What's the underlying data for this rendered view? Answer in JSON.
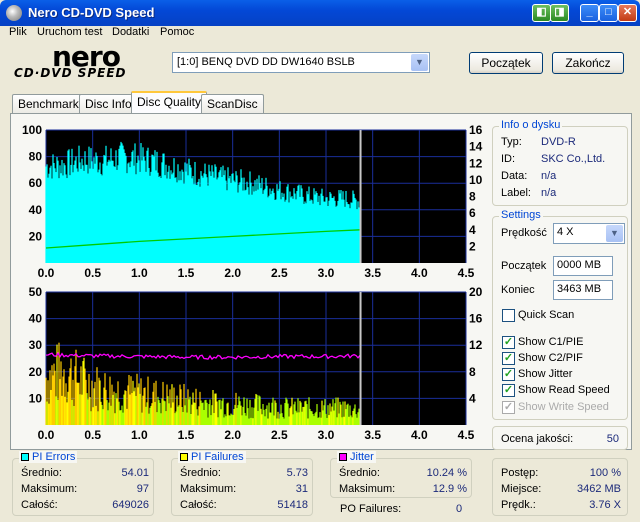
{
  "window": {
    "title": "Nero CD-DVD Speed"
  },
  "menu": [
    "Plik",
    "Uruchom test",
    "Dodatki",
    "Pomoc"
  ],
  "logo": {
    "top": "nero",
    "bottom": "CD·DVD SPEED"
  },
  "drive": {
    "selected": "[1:0]  BENQ DVD DD DW1640 BSLB"
  },
  "buttons": {
    "start": "Początek",
    "end": "Zakończ"
  },
  "tabs": [
    "Benchmark",
    "Disc Info",
    "Disc Quality",
    "ScanDisc"
  ],
  "disc_info": {
    "legend": "Info o dysku",
    "rows": [
      {
        "label": "Typ:",
        "value": "DVD-R"
      },
      {
        "label": "ID:",
        "value": "SKC Co.,Ltd."
      },
      {
        "label": "Data:",
        "value": "n/a"
      },
      {
        "label": "Label:",
        "value": "n/a"
      }
    ]
  },
  "settings": {
    "legend": "Settings",
    "speed_label": "Prędkość",
    "speed_value": "4 X",
    "start_label": "Początek",
    "start_value": "0000 MB",
    "end_label": "Koniec",
    "end_value": "3463 MB",
    "quick_scan": "Quick Scan",
    "checks": [
      {
        "label": "Show C1/PIE",
        "checked": true,
        "disabled": false
      },
      {
        "label": "Show C2/PIF",
        "checked": true,
        "disabled": false
      },
      {
        "label": "Show Jitter",
        "checked": true,
        "disabled": false
      },
      {
        "label": "Show Read Speed",
        "checked": true,
        "disabled": false
      },
      {
        "label": "Show Write Speed",
        "checked": true,
        "disabled": true
      }
    ]
  },
  "quality": {
    "label": "Ocena jakości:",
    "value": "50"
  },
  "pi_errors": {
    "legend": "PI Errors",
    "color": "#00ffff",
    "avg_label": "Średnio:",
    "avg": "54.01",
    "max_label": "Maksimum:",
    "max": "97",
    "total_label": "Całość:",
    "total": "649026"
  },
  "pi_failures": {
    "legend": "PI Failures",
    "color": "#ffff00",
    "avg_label": "Średnio:",
    "avg": "5.73",
    "max_label": "Maksimum:",
    "max": "31",
    "total_label": "Całość:",
    "total": "51418"
  },
  "jitter": {
    "legend": "Jitter",
    "color": "#ff00ff",
    "avg_label": "Średnio:",
    "avg": "10.24 %",
    "max_label": "Maksimum:",
    "max": "12.9 %",
    "po_label": "PO Failures:",
    "po": "0"
  },
  "progress": {
    "progress_label": "Postęp:",
    "progress": "100 %",
    "place_label": "Miejsce:",
    "place": "3462 MB",
    "speed_label": "Prędk.:",
    "speed": "3.76 X"
  },
  "chart_data": [
    {
      "type": "area",
      "x_ticks": [
        "0.0",
        "0.5",
        "1.0",
        "1.5",
        "2.0",
        "2.5",
        "3.0",
        "3.5",
        "4.0",
        "4.5"
      ],
      "y_left_ticks": [
        "100",
        "80",
        "60",
        "40",
        "20"
      ],
      "y_right_ticks": [
        "16",
        "14",
        "12",
        "10",
        "8",
        "6",
        "4",
        "2"
      ],
      "xlim": [
        0,
        4.5
      ],
      "ylim": [
        0,
        100
      ],
      "y2lim": [
        0,
        16
      ],
      "series": [
        {
          "values": [
            [
              0.0,
              75
            ],
            [
              0.2,
              76
            ],
            [
              0.4,
              80
            ],
            [
              0.6,
              79
            ],
            [
              0.8,
              82
            ],
            [
              1.0,
              81
            ],
            [
              1.2,
              78
            ],
            [
              1.4,
              74
            ],
            [
              1.6,
              70
            ],
            [
              1.8,
              67
            ],
            [
              2.0,
              64
            ],
            [
              2.2,
              62
            ],
            [
              2.4,
              58
            ],
            [
              2.6,
              55
            ],
            [
              2.8,
              52
            ],
            [
              3.0,
              50
            ],
            [
              3.2,
              50
            ],
            [
              3.37,
              48
            ]
          ]
        },
        {
          "values": [
            [
              0.0,
              1.8
            ],
            [
              0.5,
              2.2
            ],
            [
              1.0,
              2.6
            ],
            [
              1.5,
              2.9
            ],
            [
              2.0,
              3.2
            ],
            [
              2.5,
              3.5
            ],
            [
              3.0,
              3.8
            ],
            [
              3.37,
              4.0
            ]
          ]
        }
      ],
      "colors": [
        "#00ffff",
        "#00cc00"
      ]
    },
    {
      "type": "bar",
      "x_ticks": [
        "0.0",
        "0.5",
        "1.0",
        "1.5",
        "2.0",
        "2.5",
        "3.0",
        "3.5",
        "4.0",
        "4.5"
      ],
      "y_left_ticks": [
        "50",
        "40",
        "30",
        "20",
        "10"
      ],
      "y_right_ticks": [
        "20",
        "16",
        "12",
        "8",
        "4"
      ],
      "xlim": [
        0,
        4.5
      ],
      "ylim": [
        0,
        50
      ],
      "y2lim": [
        0,
        20
      ],
      "series": [
        {
          "values": [
            [
              0.0,
              20
            ],
            [
              0.2,
              22
            ],
            [
              0.4,
              18
            ],
            [
              0.6,
              15
            ],
            [
              0.8,
              14
            ],
            [
              1.0,
              13
            ],
            [
              1.2,
              12
            ],
            [
              1.4,
              11
            ],
            [
              1.6,
              10
            ],
            [
              1.8,
              9
            ],
            [
              2.0,
              9
            ],
            [
              2.2,
              8
            ],
            [
              2.4,
              8
            ],
            [
              2.6,
              7
            ],
            [
              2.8,
              7
            ],
            [
              3.0,
              7
            ],
            [
              3.2,
              7
            ],
            [
              3.37,
              6
            ]
          ]
        },
        {
          "values": [
            [
              0.0,
              10.6
            ],
            [
              0.5,
              10.4
            ],
            [
              1.0,
              10.3
            ],
            [
              1.5,
              10.2
            ],
            [
              2.0,
              10.2
            ],
            [
              2.5,
              10.3
            ],
            [
              3.0,
              10.3
            ],
            [
              3.37,
              10.4
            ]
          ]
        }
      ],
      "colors": [
        "#aaff00",
        "#ff00ff"
      ]
    }
  ]
}
